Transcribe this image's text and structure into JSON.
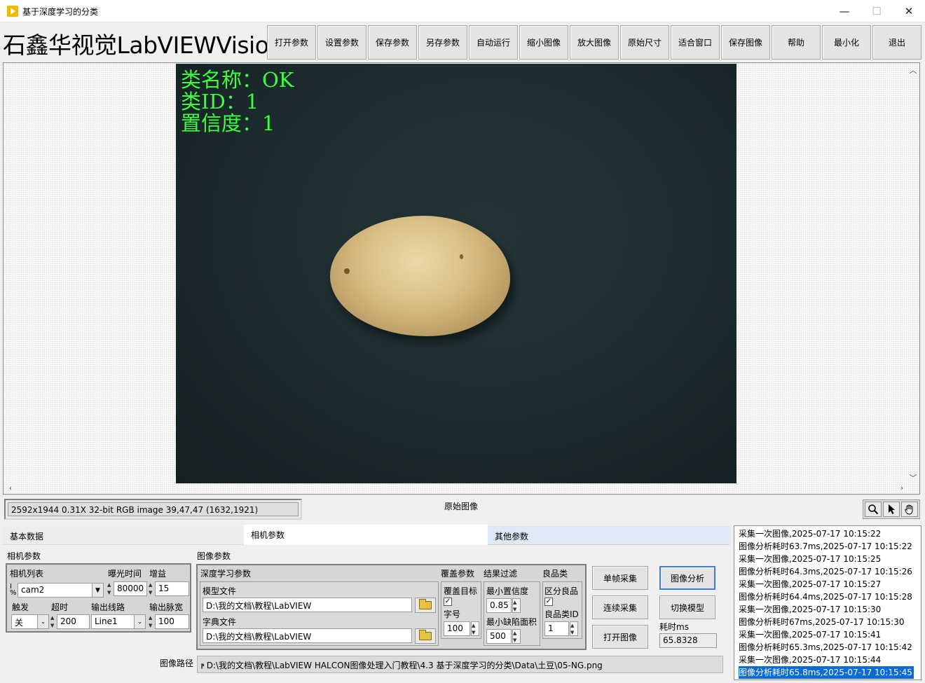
{
  "window": {
    "title": "基于深度学习的分类",
    "minimize_glyph": "—",
    "maximize_glyph": "☐",
    "close_glyph": "✕"
  },
  "header": {
    "brand": "石鑫华视觉LabVIEWVision",
    "toolbar": [
      "打开参数",
      "设置参数",
      "保存参数",
      "另存参数",
      "自动运行",
      "缩小图像",
      "放大图像",
      "原始尺寸",
      "适合窗口",
      "保存图像",
      "帮助",
      "最小化",
      "退出"
    ]
  },
  "viewer": {
    "overlay": {
      "class_name": "类名称：OK",
      "class_id": "类ID：1",
      "confidence": "置信度：1"
    },
    "status": "2592x1944 0.31X 32-bit RGB image 39,47,47    (1632,1921)",
    "image_label": "原始图像",
    "tools": [
      "zoom-icon",
      "pointer-icon",
      "pan-hand-icon"
    ]
  },
  "tabs": {
    "basic": "基本数据",
    "camera": "相机参数",
    "other": "其他参数"
  },
  "camera_params": {
    "group_label": "相机参数",
    "camera_list_label": "相机列表",
    "camera_list_value": "cam2",
    "exposure_label": "曝光时间",
    "exposure_value": "80000",
    "gain_label": "增益",
    "gain_value": "15",
    "trigger_label": "触发",
    "trigger_value": "关",
    "timeout_label": "超时",
    "timeout_value": "200",
    "output_line_label": "输出线路",
    "output_line_value": "Line1",
    "output_pulse_label": "输出脉宽",
    "output_pulse_value": "100"
  },
  "image_params": {
    "group_label": "图像参数",
    "dl_label": "深度学习参数",
    "model_file_label": "模型文件",
    "model_file_value": "D:\\我的文档\\教程\\LabVIEW",
    "dict_file_label": "字典文件",
    "dict_file_value": "D:\\我的文档\\教程\\LabVIEW",
    "overlay_label": "覆盖参数",
    "overlay_target_label": "覆盖目标",
    "overlay_target_checked": true,
    "font_size_label": "字号",
    "font_size_value": "100",
    "filter_label": "结果过滤",
    "min_conf_label": "最小置信度",
    "min_conf_value": "0.85",
    "min_defect_label": "最小缺陷面积",
    "min_defect_value": "500",
    "good_label": "良品类",
    "distinguish_label": "区分良品",
    "distinguish_checked": true,
    "good_id_label": "良品类ID",
    "good_id_value": "1"
  },
  "actions": {
    "single_grab": "单帧采集",
    "analyze": "图像分析",
    "continuous_grab": "连续采集",
    "switch_model": "切换模型",
    "open_image": "打开图像",
    "time_label": "耗时ms",
    "time_value": "65.8328"
  },
  "image_path": {
    "label": "图像路径",
    "value": "D:\\我的文档\\教程\\LabVIEW HALCON图像处理入门教程\\4.3 基于深度学习的分类\\Data\\土豆\\05-NG.png"
  },
  "log": [
    "采集一次图像,2025-07-17 10:15:22",
    "图像分析耗时63.7ms,2025-07-17 10:15:22",
    "采集一次图像,2025-07-17 10:15:25",
    "图像分析耗时64.3ms,2025-07-17 10:15:26",
    "采集一次图像,2025-07-17 10:15:27",
    "图像分析耗时64.4ms,2025-07-17 10:15:28",
    "采集一次图像,2025-07-17 10:15:30",
    "图像分析耗时67ms,2025-07-17 10:15:30",
    "采集一次图像,2025-07-17 10:15:41",
    "图像分析耗时65.3ms,2025-07-17 10:15:42",
    "采集一次图像,2025-07-17 10:15:44",
    "图像分析耗时65.8ms,2025-07-17 10:15:45"
  ],
  "colors": {
    "overlay_text": "#3dff3d",
    "selection": "#0a6ad8",
    "image_background": "#1c2b2e"
  }
}
